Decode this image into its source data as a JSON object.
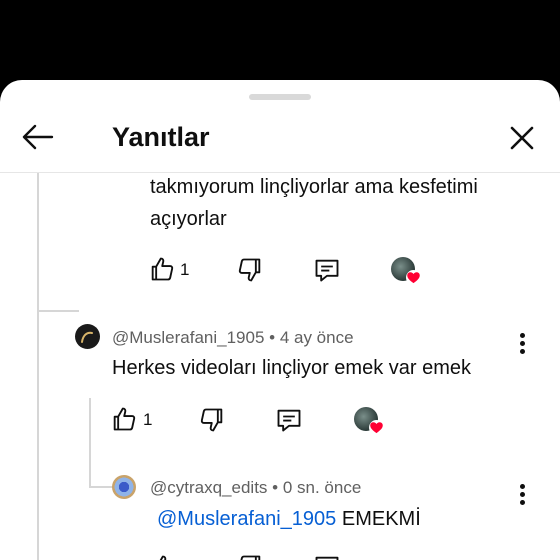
{
  "header": {
    "title": "Yanıtlar"
  },
  "comment_prev": {
    "text_line1": "takmıyorum linçliyorlar ama kesfetimi",
    "text_line2": "açıyorlar",
    "like_count": "1"
  },
  "comment_2": {
    "author": "@Muslerafani_1905",
    "time": "4 ay önce",
    "text": "Herkes videoları linçliyor emek var emek",
    "like_count": "1"
  },
  "comment_3": {
    "author": "@cytraxq_edits",
    "time": "0 sn. önce",
    "mention": "@Muslerafani_1905",
    "text": "EMEKMİ"
  },
  "colors": {
    "mention": "#065fd4",
    "heart": "#ff0033",
    "meta": "#606060"
  }
}
